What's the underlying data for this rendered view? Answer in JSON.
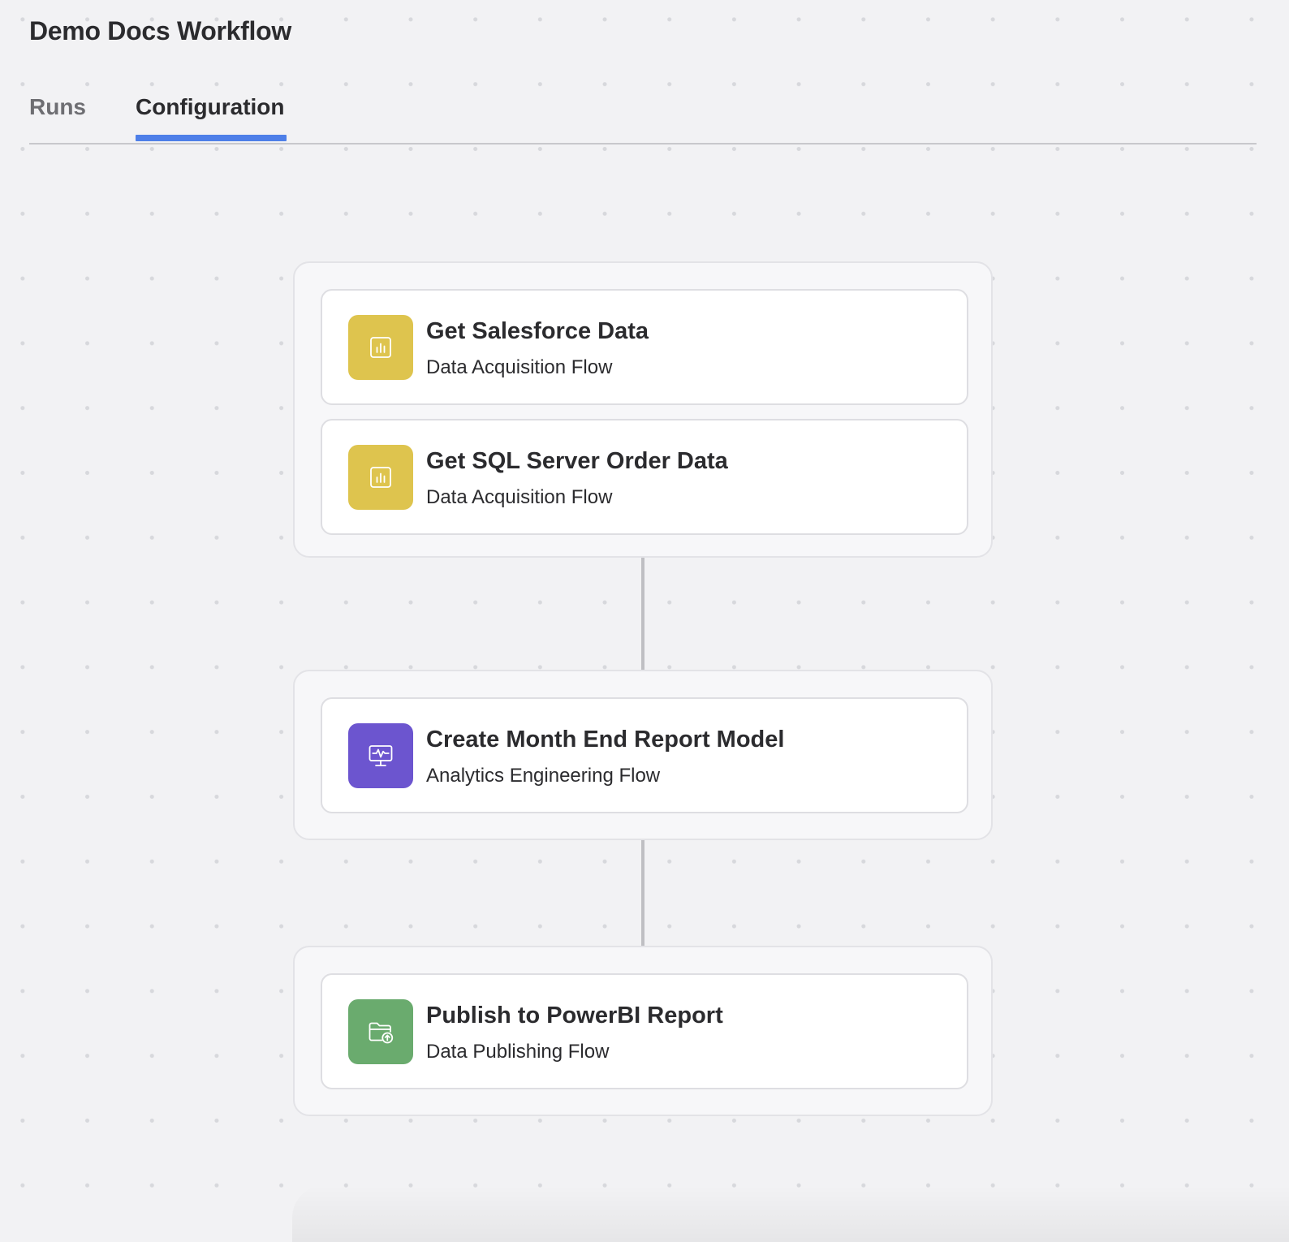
{
  "header": {
    "title": "Demo Docs Workflow"
  },
  "tabs": [
    {
      "label": "Runs",
      "active": false
    },
    {
      "label": "Configuration",
      "active": true
    }
  ],
  "colors": {
    "tab_active_underline": "#4e7fe8",
    "data_acquisition": "#dec44e",
    "analytics_engineering": "#6c55cf",
    "data_publishing": "#6aab6e"
  },
  "groups": [
    {
      "cards": [
        {
          "title": "Get Salesforce Data",
          "subtitle": "Data Acquisition Flow",
          "icon": "bar-chart-icon"
        },
        {
          "title": "Get SQL Server Order Data",
          "subtitle": "Data Acquisition Flow",
          "icon": "bar-chart-icon"
        }
      ]
    },
    {
      "cards": [
        {
          "title": "Create Month End Report Model",
          "subtitle": "Analytics Engineering Flow",
          "icon": "monitor-pulse-icon"
        }
      ]
    },
    {
      "cards": [
        {
          "title": "Publish to PowerBI Report",
          "subtitle": "Data Publishing Flow",
          "icon": "folder-upload-icon"
        }
      ]
    }
  ]
}
